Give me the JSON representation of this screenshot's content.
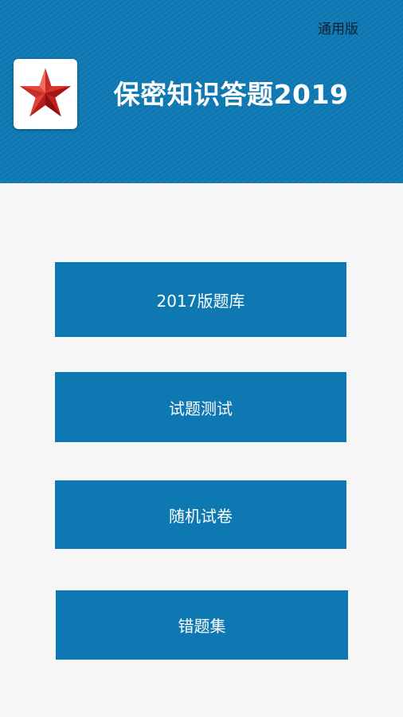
{
  "header": {
    "edition_label": "通用版",
    "title": "保密知识答题2019",
    "logo_icon": "red-star-icon",
    "background_color": "#0e78b3"
  },
  "menu": {
    "button_color": "#0e78b3",
    "items": [
      {
        "label": "2017版题库"
      },
      {
        "label": "试题测试"
      },
      {
        "label": "随机试卷"
      },
      {
        "label": "错题集"
      }
    ]
  }
}
